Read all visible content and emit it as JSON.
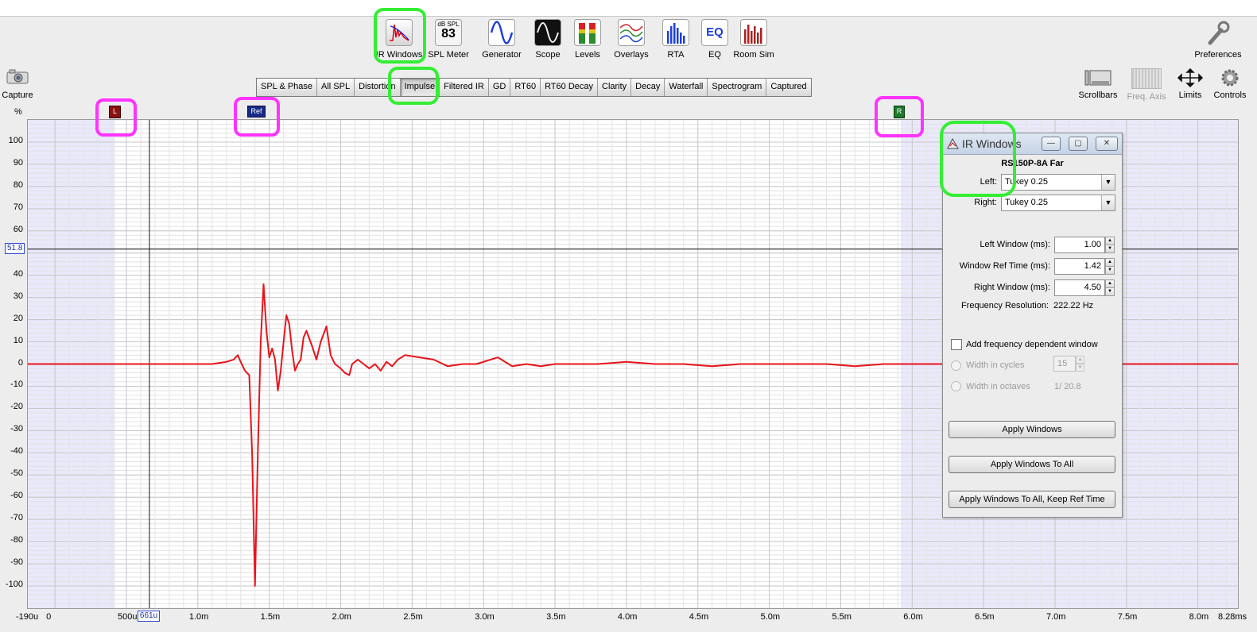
{
  "toolbar": {
    "items": [
      {
        "label": "IR Windows",
        "icon": "ir-windows-icon"
      },
      {
        "label": "SPL Meter",
        "icon": "spl-meter-icon",
        "icon_top": "dB SPL",
        "icon_value": "83"
      },
      {
        "label": "Generator",
        "icon": "generator-icon"
      },
      {
        "label": "Scope",
        "icon": "scope-icon"
      },
      {
        "label": "Levels",
        "icon": "levels-icon"
      },
      {
        "label": "Overlays",
        "icon": "overlays-icon"
      },
      {
        "label": "RTA",
        "icon": "rta-icon"
      },
      {
        "label": "EQ",
        "icon": "eq-icon",
        "icon_text": "EQ"
      },
      {
        "label": "Room Sim",
        "icon": "room-sim-icon"
      }
    ],
    "preferences": "Preferences",
    "capture": "Capture"
  },
  "tabs": [
    "SPL & Phase",
    "All SPL",
    "Distortion",
    "Impulse",
    "Filtered IR",
    "GD",
    "RT60",
    "RT60 Decay",
    "Clarity",
    "Decay",
    "Waterfall",
    "Spectrogram",
    "Captured"
  ],
  "active_tab": "Impulse",
  "right_tools": {
    "scrollbars": "Scrollbars",
    "freq_axis": "Freq. Axis",
    "limits": "Limits",
    "controls": "Controls"
  },
  "markers": {
    "left": "L",
    "ref": "Ref",
    "right": "R"
  },
  "plot": {
    "y_unit": "%",
    "cursor_y": "51.8",
    "cursor_x": "661u"
  },
  "chart_data": {
    "type": "line",
    "title": "",
    "xlabel": "",
    "ylabel": "%",
    "x_unit": "ms",
    "xlim": [
      -0.19,
      8.28
    ],
    "ylim": [
      -110,
      110
    ],
    "y_ticks": [
      "100",
      "90",
      "80",
      "70",
      "60",
      "50",
      "40",
      "30",
      "20",
      "10",
      "0",
      "-10",
      "-20",
      "-30",
      "-40",
      "-50",
      "-60",
      "-70",
      "-80",
      "-90",
      "-100"
    ],
    "x_ticks": [
      {
        "v": -0.19,
        "label": "-190u"
      },
      {
        "v": 0,
        "label": "0"
      },
      {
        "v": 0.5,
        "label": "500u"
      },
      {
        "v": 1.0,
        "label": "1.0m"
      },
      {
        "v": 1.5,
        "label": "1.5m"
      },
      {
        "v": 2.0,
        "label": "2.0m"
      },
      {
        "v": 2.5,
        "label": "2.5m"
      },
      {
        "v": 3.0,
        "label": "3.0m"
      },
      {
        "v": 3.5,
        "label": "3.5m"
      },
      {
        "v": 4.0,
        "label": "4.0m"
      },
      {
        "v": 4.5,
        "label": "4.5m"
      },
      {
        "v": 5.0,
        "label": "5.0m"
      },
      {
        "v": 5.5,
        "label": "5.5m"
      },
      {
        "v": 6.0,
        "label": "6.0m"
      },
      {
        "v": 6.5,
        "label": "6.5m"
      },
      {
        "v": 7.0,
        "label": "7.0m"
      },
      {
        "v": 7.5,
        "label": "7.5m"
      },
      {
        "v": 8.0,
        "label": "8.0m"
      },
      {
        "v": 8.28,
        "label": "8.28ms"
      }
    ],
    "window_left_ms": 0.42,
    "window_right_ms": 5.92,
    "cursor": {
      "x": 0.661,
      "y": 51.8
    },
    "series": [
      {
        "color": "#e8141b",
        "x": [
          -0.19,
          0.5,
          1.0,
          1.1,
          1.2,
          1.25,
          1.28,
          1.3,
          1.33,
          1.36,
          1.38,
          1.4,
          1.42,
          1.44,
          1.46,
          1.48,
          1.5,
          1.52,
          1.54,
          1.56,
          1.58,
          1.6,
          1.62,
          1.64,
          1.66,
          1.68,
          1.7,
          1.72,
          1.74,
          1.76,
          1.8,
          1.83,
          1.86,
          1.9,
          1.93,
          1.96,
          2.0,
          2.03,
          2.06,
          2.08,
          2.12,
          2.16,
          2.2,
          2.24,
          2.28,
          2.32,
          2.36,
          2.4,
          2.45,
          2.55,
          2.65,
          2.75,
          2.85,
          2.95,
          3.1,
          3.2,
          3.3,
          3.4,
          3.5,
          3.6,
          3.8,
          4.0,
          4.2,
          4.4,
          4.6,
          4.8,
          5.0,
          5.2,
          5.4,
          5.6,
          5.8,
          6.0,
          6.5,
          7.0,
          7.5,
          8.0,
          8.28
        ],
        "y": [
          0,
          0,
          0,
          0,
          1,
          2,
          4,
          1,
          -3,
          -5,
          -40,
          -100,
          -40,
          10,
          36,
          15,
          3,
          7,
          2,
          -12,
          -3,
          10,
          22,
          18,
          6,
          -3,
          0,
          2,
          12,
          15,
          8,
          2,
          10,
          17,
          4,
          0,
          -2,
          -4,
          -5,
          0,
          2,
          0,
          -2,
          0,
          -3,
          1,
          -1,
          2,
          4,
          3,
          2,
          -1,
          0,
          0,
          3,
          -1,
          0,
          -1,
          0,
          0,
          0,
          1,
          0,
          0,
          -1,
          0,
          0,
          0,
          0,
          -1,
          0,
          0,
          0,
          0,
          0,
          0,
          0
        ]
      }
    ]
  },
  "dialog": {
    "title": "IR Windows",
    "measurement": "RS150P-8A Far",
    "left_label": "Left:",
    "left_value": "Tukey 0.25",
    "right_label": "Right:",
    "right_value": "Tukey 0.25",
    "left_window_label": "Left Window (ms):",
    "left_window_value": "1.00",
    "ref_time_label": "Window Ref Time (ms):",
    "ref_time_value": "1.42",
    "right_window_label": "Right Window (ms):",
    "right_window_value": "4.50",
    "freq_res_label": "Frequency Resolution:",
    "freq_res_value": "222.22 Hz",
    "fdw_label": "Add frequency dependent window",
    "width_cycles_label": "Width in cycles",
    "width_cycles_value": "15",
    "width_octaves_label": "Width in octaves",
    "width_octaves_value": "1/ 20.8",
    "apply": "Apply Windows",
    "apply_all": "Apply Windows To All",
    "apply_all_keep": "Apply Windows To All, Keep Ref Time",
    "min_glyph": "—",
    "max_glyph": "▢",
    "close_glyph": "✕"
  }
}
